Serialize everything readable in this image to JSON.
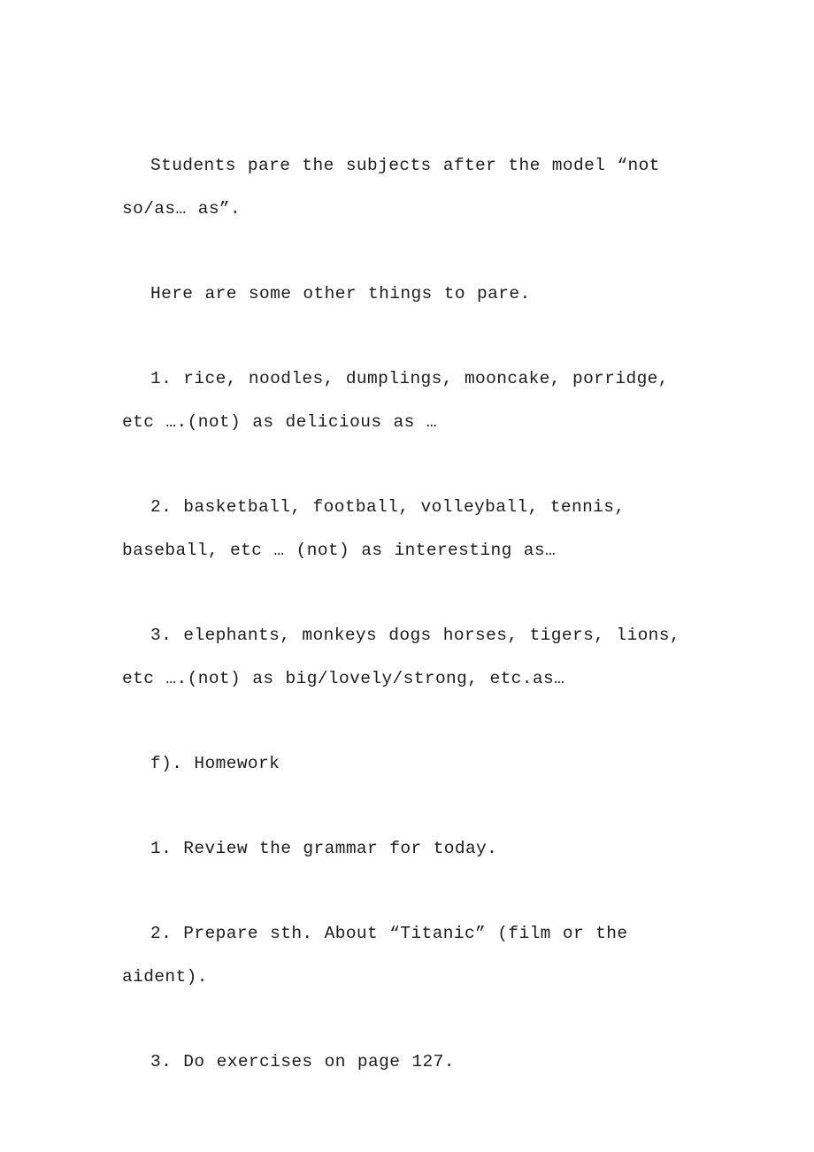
{
  "document": {
    "page_background": "#ffffff",
    "text_color": "#1c1c1c",
    "paragraphs": [
      {
        "id": "intro-model-sentence",
        "text": "Students pare the subjects after the model “not so/as… as”."
      },
      {
        "id": "here-are-some-other-things",
        "text": "Here are some other things to pare."
      },
      {
        "id": "list-item-1-food",
        "text": "1. rice, noodles, dumplings, mooncake, porridge, etc ….(not) as delicious as …"
      },
      {
        "id": "list-item-2-sports",
        "text": "2. basketball, football, volleyball, tennis, baseball, etc … (not) as interesting as…"
      },
      {
        "id": "list-item-3-animals",
        "text": "3. elephants, monkeys dogs horses, tigers, lions, etc ….(not) as big/lovely/strong, etc.as…"
      },
      {
        "id": "section-heading-homework",
        "text": "f). Homework"
      },
      {
        "id": "homework-item-1",
        "text": "1. Review the grammar for today."
      },
      {
        "id": "homework-item-2",
        "text": "2. Prepare sth. About “Titanic” (film or the aident)."
      },
      {
        "id": "homework-item-3",
        "text": "3. Do exercises on page 127."
      }
    ]
  }
}
